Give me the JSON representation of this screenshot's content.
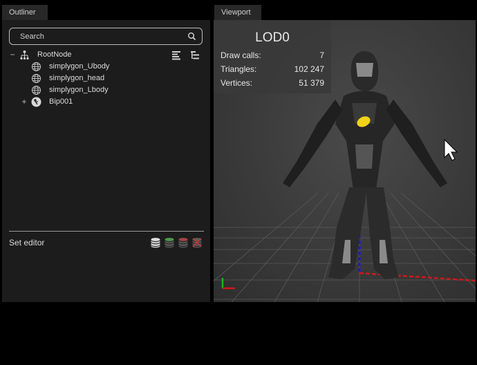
{
  "outliner": {
    "tab_label": "Outliner",
    "search": {
      "placeholder": "Search"
    },
    "tree": [
      {
        "label": "RootNode",
        "expander": "−",
        "icon": "scene-root-icon"
      },
      {
        "label": "simplygon_Ubody",
        "icon": "mesh-sphere-icon"
      },
      {
        "label": "simplygon_head",
        "icon": "mesh-sphere-icon"
      },
      {
        "label": "simplygon_Lbody",
        "icon": "mesh-sphere-icon"
      },
      {
        "label": "Bip001",
        "expander": "+",
        "icon": "bone-icon"
      }
    ],
    "set_editor": {
      "title": "Set editor"
    }
  },
  "viewport": {
    "tab_label": "Viewport",
    "stats": {
      "title": "LOD0",
      "rows": [
        {
          "label": "Draw calls:",
          "value": "7"
        },
        {
          "label": "Triangles:",
          "value": "102 247"
        },
        {
          "label": "Vertices:",
          "value": "51 379"
        }
      ]
    },
    "colors": {
      "axis_x": "#d01818",
      "axis_y": "#18b818",
      "axis_z": "#1818d8",
      "emblem": "#f2d21a"
    }
  }
}
